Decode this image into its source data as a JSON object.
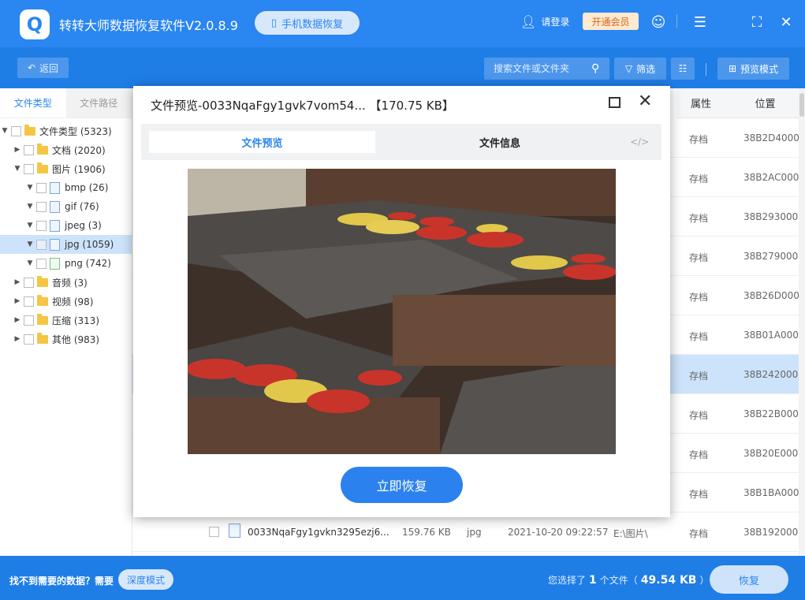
{
  "app": {
    "title": "转转大师数据恢复软件V2.0.8.9",
    "phone_recovery": "手机数据恢复",
    "login": "请登录",
    "vip": "开通会员"
  },
  "toolbar": {
    "back": "返回",
    "search_placeholder": "搜索文件或文件夹",
    "filter": "筛选",
    "preview_mode": "预览模式"
  },
  "sidebar": {
    "tabs": [
      "文件类型",
      "文件路径"
    ],
    "tree": [
      {
        "label": "文件类型 (5323)"
      },
      {
        "label": "文档 (2020)"
      },
      {
        "label": "图片 (1906)"
      },
      {
        "label": "bmp (26)"
      },
      {
        "label": "gif (76)"
      },
      {
        "label": "jpeg (3)"
      },
      {
        "label": "jpg (1059)"
      },
      {
        "label": "png (742)"
      },
      {
        "label": "音频 (3)"
      },
      {
        "label": "视频 (98)"
      },
      {
        "label": "压缩 (313)"
      },
      {
        "label": "其他 (983)"
      }
    ]
  },
  "table": {
    "headers": {
      "attr": "属性",
      "position": "位置"
    },
    "rows": [
      {
        "attr": "存档",
        "position": "38B2D4000"
      },
      {
        "attr": "存档",
        "position": "38B2AC000"
      },
      {
        "attr": "存档",
        "position": "38B293000"
      },
      {
        "attr": "存档",
        "position": "38B279000"
      },
      {
        "attr": "存档",
        "position": "38B26D000"
      },
      {
        "attr": "存档",
        "position": "38B01A000"
      },
      {
        "attr": "存档",
        "position": "38B242000"
      },
      {
        "attr": "存档",
        "position": "38B22B000"
      },
      {
        "attr": "存档",
        "position": "38B20E000"
      },
      {
        "attr": "存档",
        "position": "38B1BA000"
      },
      {
        "name": "0033NqaFgy1gvkn3295ezj6...",
        "size": "159.76 KB",
        "type": "jpg",
        "date": "2021-10-20 09:22:57",
        "path": "E:\\图片\\",
        "attr": "存档",
        "position": "38B192000"
      }
    ]
  },
  "modal": {
    "title": "文件预览-0033NqaFgy1gvk7vom54...  【170.75 KB】",
    "tab_preview": "文件预览",
    "tab_info": "文件信息",
    "code": "</>",
    "recover_now": "立即恢复"
  },
  "footer": {
    "not_found": "找不到需要的数据？需要",
    "deep_mode": "深度模式",
    "selected_prefix": "您选择了",
    "selected_count": "1",
    "selected_unit": "个文件（",
    "selected_size": "49.54 KB",
    "selected_suffix": "）",
    "recover": "恢复"
  },
  "colors": {
    "primary": "#2a86f0",
    "toolbar": "#1f7de6",
    "selected_row": "#cde3fb"
  }
}
